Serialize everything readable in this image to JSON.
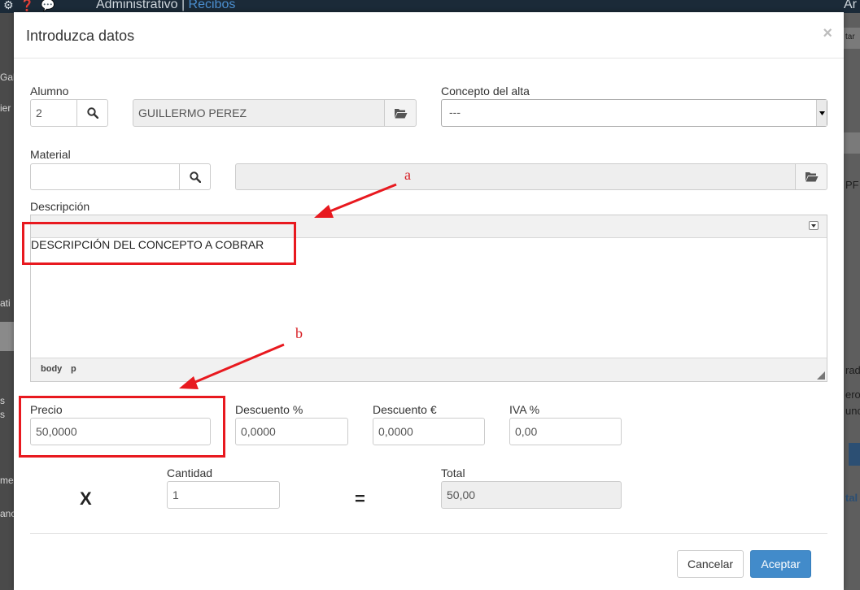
{
  "background": {
    "title_static": "Administrativo",
    "title_separator": "|",
    "title_link": "Recibos",
    "right_text": "Ar",
    "side_texts": [
      "Gal",
      "ier",
      "ati",
      "s",
      "s",
      "me",
      "anc"
    ],
    "right_texts": [
      "tar",
      "PF",
      "rad",
      "ero",
      "unc",
      "tal"
    ]
  },
  "modal": {
    "title": "Introduzca datos",
    "close_symbol": "×",
    "alumno": {
      "label": "Alumno",
      "code_value": "2",
      "name_value": "GUILLERMO PEREZ"
    },
    "concepto_alta": {
      "label": "Concepto del alta",
      "selected": "---"
    },
    "material": {
      "label": "Material",
      "code_value": "",
      "name_value": ""
    },
    "descripcion": {
      "label": "Descripción",
      "content": "DESCRIPCIÓN DEL CONCEPTO A COBRAR",
      "path": [
        "body",
        "p"
      ]
    },
    "precio": {
      "label": "Precio",
      "value": "50,0000"
    },
    "descuento_pct": {
      "label": "Descuento %",
      "value": "0,0000"
    },
    "descuento_eur": {
      "label": "Descuento €",
      "value": "0,0000"
    },
    "iva": {
      "label": "IVA %",
      "value": "0,00"
    },
    "multiply_symbol": "X",
    "cantidad": {
      "label": "Cantidad",
      "value": "1"
    },
    "equals_symbol": "=",
    "total": {
      "label": "Total",
      "value": "50,00"
    },
    "buttons": {
      "cancel": "Cancelar",
      "accept": "Aceptar"
    }
  },
  "annotations": {
    "a": "a",
    "b": "b",
    "color": "#e8191f"
  },
  "colors": {
    "primary": "#428bca",
    "readonly_bg": "#eeeeee",
    "link": "#4b8fd0"
  }
}
